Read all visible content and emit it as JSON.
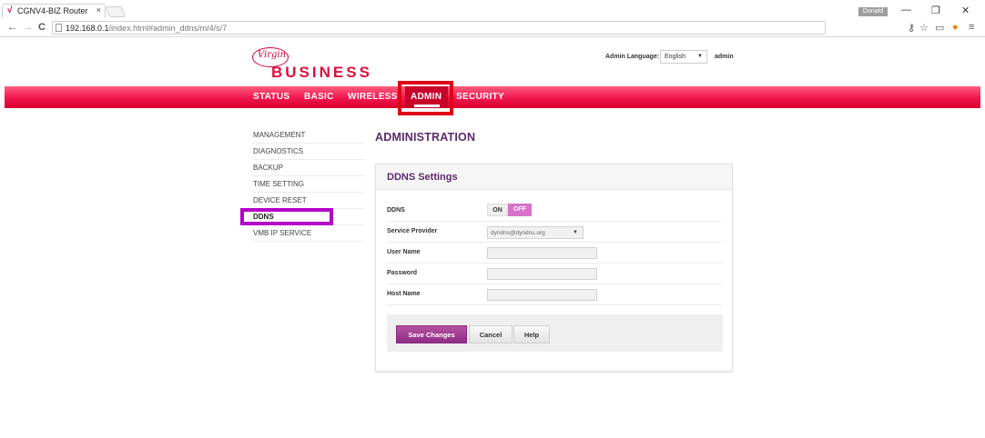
{
  "browser": {
    "tab_title": "CGNV4-BIZ Router",
    "tab_close": "×",
    "user_badge": "Donald",
    "url_host": "192.168.0.1",
    "url_path": "/index.html#admin_ddns/m/4/s/7",
    "back": "←",
    "forward": "→",
    "reload": "C",
    "minimize": "—",
    "restore": "❐",
    "close": "✕"
  },
  "header": {
    "logo_text": "Virgin",
    "brand": "BUSINESS",
    "admin_language_label": "Admin Language:",
    "admin_language_value": "English",
    "user": "admin"
  },
  "nav": {
    "items": [
      "STATUS",
      "BASIC",
      "WIRELESS",
      "ADMIN",
      "SECURITY"
    ],
    "active": "ADMIN"
  },
  "sidebar": {
    "items": [
      "MANAGEMENT",
      "DIAGNOSTICS",
      "BACKUP",
      "TIME SETTING",
      "DEVICE RESET",
      "DDNS",
      "VMB IP SERVICE"
    ],
    "active": "DDNS"
  },
  "main": {
    "page_title": "ADMINISTRATION",
    "panel_title": "DDNS Settings",
    "ddns_label": "DDNS",
    "toggle_on": "ON",
    "toggle_off": "OFF",
    "toggle_state": "OFF",
    "provider_label": "Service Provider",
    "provider_value": "dyndns@dyndns.org",
    "username_label": "User Name",
    "username_value": "",
    "password_label": "Password",
    "password_value": "",
    "hostname_label": "Host Name",
    "hostname_value": "",
    "save_label": "Save Changes",
    "cancel_label": "Cancel",
    "help_label": "Help"
  },
  "colors": {
    "brand_red": "#e0103c",
    "nav_gradient_top": "#ff5d7f",
    "nav_gradient_bottom": "#d8002e",
    "title_purple": "#5b2a6e",
    "primary_button": "#a0398f",
    "toggle_off": "#d673c8",
    "highlight_red": "#e00018",
    "highlight_magenta": "#b400c8"
  }
}
